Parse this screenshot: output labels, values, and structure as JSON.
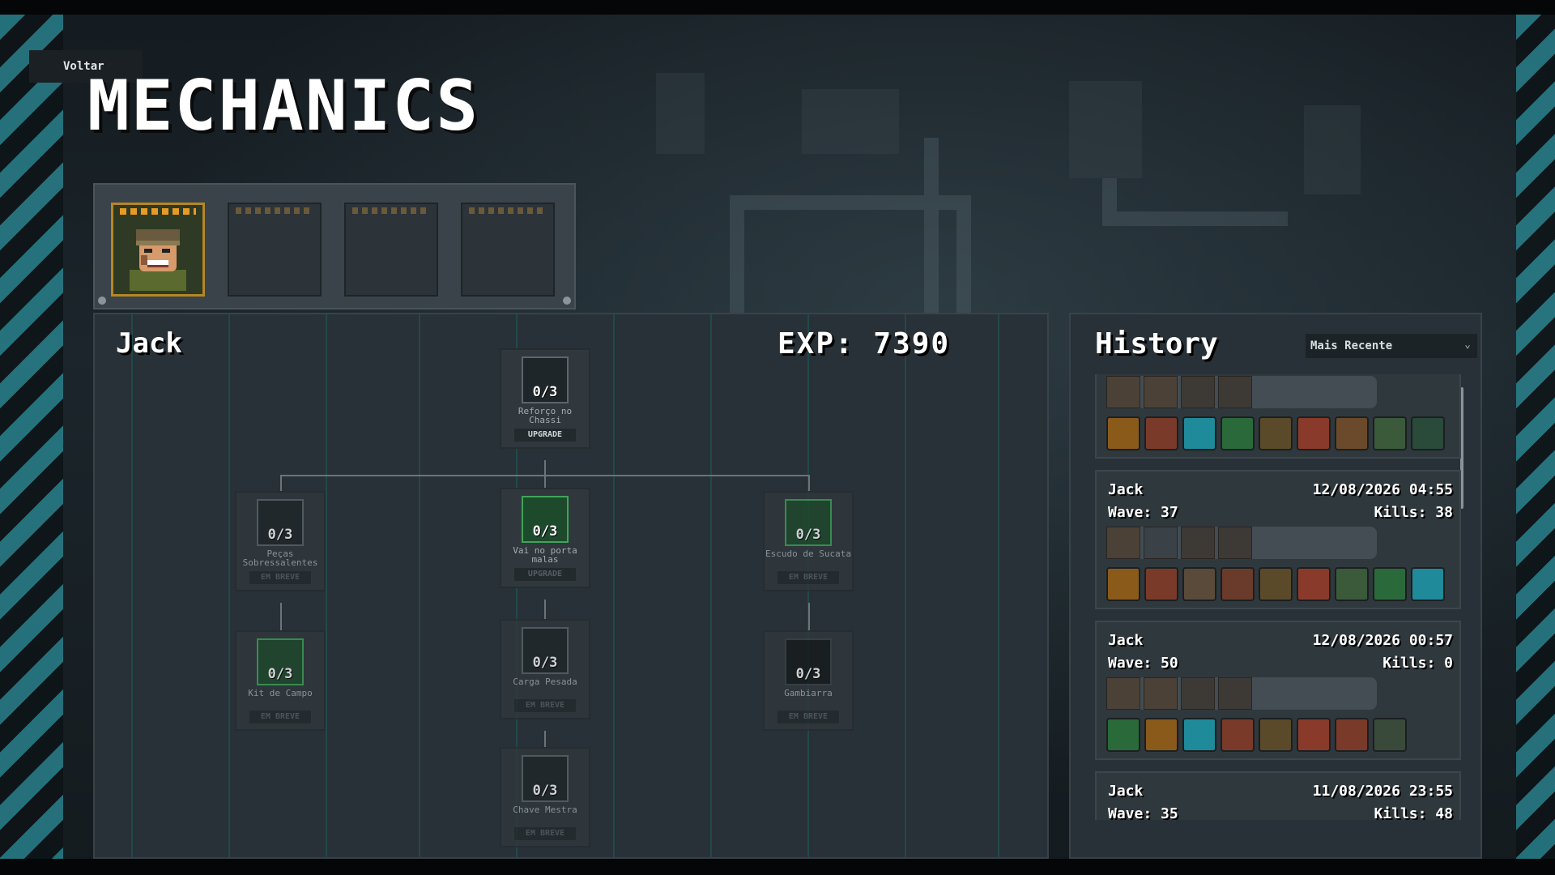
{
  "header": {
    "back_label": "Voltar",
    "title": "MECHANICS"
  },
  "characters": [
    {
      "name": "Jack",
      "selected": true
    },
    {
      "name": "",
      "selected": false
    },
    {
      "name": "",
      "selected": false
    },
    {
      "name": "",
      "selected": false
    }
  ],
  "tree": {
    "character_name": "Jack",
    "exp_label": "EXP: 7390",
    "nodes": [
      {
        "id": "reforco",
        "count": "0/3",
        "name": "Reforço no Chassi",
        "action": "UPGRADE",
        "state": "upgrade"
      },
      {
        "id": "pecas",
        "count": "0/3",
        "name": "Peças Sobressalentes",
        "action": "EM BREVE",
        "state": "locked"
      },
      {
        "id": "vai",
        "count": "0/3",
        "name": "Vai no porta malas",
        "action": "UPGRADE",
        "state": "upgrade"
      },
      {
        "id": "escudo",
        "count": "0/3",
        "name": "Escudo de Sucata",
        "action": "EM BREVE",
        "state": "locked"
      },
      {
        "id": "kit",
        "count": "0/3",
        "name": "Kit de Campo",
        "action": "EM BREVE",
        "state": "locked"
      },
      {
        "id": "carga",
        "count": "0/3",
        "name": "Carga Pesada",
        "action": "EM BREVE",
        "state": "locked"
      },
      {
        "id": "gambiarra",
        "count": "0/3",
        "name": "Gambiarra",
        "action": "EM BREVE",
        "state": "locked"
      },
      {
        "id": "chave",
        "count": "0/3",
        "name": "Chave Mestra",
        "action": "EM BREVE",
        "state": "locked"
      }
    ]
  },
  "history": {
    "title": "History",
    "sort_value": "Mais Recente",
    "entries": [
      {
        "name": "Jack",
        "datetime": "12/08/2026 04:55",
        "wave": "Wave: 37",
        "kills": "Kills: 38"
      },
      {
        "name": "Jack",
        "datetime": "12/08/2026 00:57",
        "wave": "Wave: 50",
        "kills": "Kills: 0"
      },
      {
        "name": "Jack",
        "datetime": "11/08/2026 23:55",
        "wave": "Wave: 35",
        "kills": "Kills: 48"
      }
    ]
  },
  "colors": {
    "accent": "#e79a24",
    "stripe": "#2a8c98",
    "panel": "#283137",
    "upgrade_green": "#3fa45a"
  },
  "icons": [
    "back-arrow-icon",
    "chevron-down-icon",
    "weapon-icon",
    "item-icon"
  ]
}
